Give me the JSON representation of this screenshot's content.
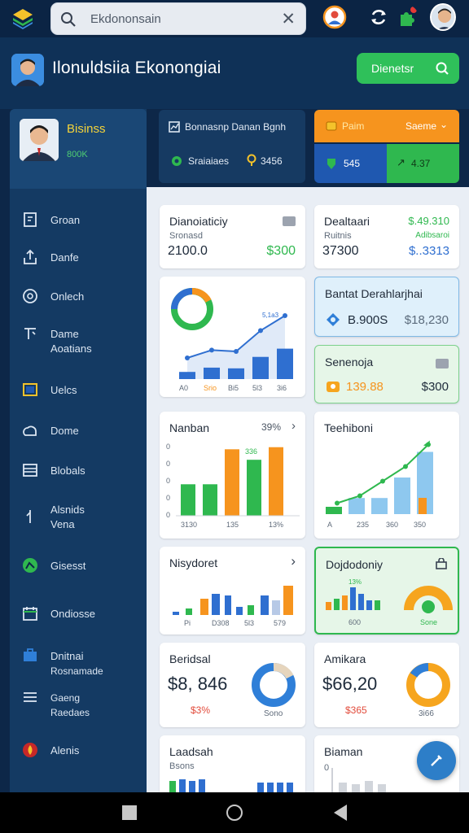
{
  "search": {
    "value": "Ekdononsain"
  },
  "header": {
    "title": "Ilonuldsiia Ekonongiai",
    "button_label": "Dienetsr"
  },
  "profile": {
    "name": "Bisinss",
    "sub": "800K"
  },
  "sidebar": {
    "items": [
      {
        "label": "Groan"
      },
      {
        "label": "Danfe"
      },
      {
        "label": "Onlech"
      },
      {
        "label": "Dame",
        "sub": "Aoatians"
      },
      {
        "label": "Uelcs"
      },
      {
        "label": "Dome"
      },
      {
        "label": "Blobals"
      },
      {
        "label": "Alsnids",
        "sub": "Vena"
      },
      {
        "label": "Gisesst"
      },
      {
        "label": "Ondiosse"
      },
      {
        "label": "Dnitnai",
        "sub": "Rosnamade"
      },
      {
        "label": "Gaeng",
        "sub": "Raedaes"
      },
      {
        "label": "Alenis"
      }
    ]
  },
  "summary_dark": {
    "title": "Bonnasnp Danan Bgnh",
    "stat_label": "Sraiaiaes",
    "stat_value": "3456"
  },
  "summary_orange": {
    "left": "Paim",
    "right": "Saeme",
    "bottom_left": "545",
    "bottom_right": "4.37"
  },
  "cards": {
    "c1": {
      "title": "Dianoiaticiy",
      "sub": "Sronasd",
      "value": "2100.0",
      "value2": "$300"
    },
    "c2": {
      "title": "Dealtaari",
      "sub": "Ruitnis",
      "value": "37300",
      "price": "$.49.310",
      "price_sub": "Adibsaroi",
      "price2": "$..3313"
    },
    "c3": {
      "x_labels": [
        "A0",
        "Srio",
        "Bi5",
        "5l3",
        "3i6"
      ],
      "value_label": "5,1a3"
    },
    "c4": {
      "title": "Bantat Derahlarjhai",
      "value": "B.900S",
      "value2": "$18,230"
    },
    "c5": {
      "title": "Senenoja",
      "value": "139.88",
      "value2": "$300"
    },
    "c6": {
      "title": "Nanban",
      "pct": "39%",
      "x_labels": [
        "3130",
        "135",
        "13%"
      ],
      "y_labels": [
        "0",
        "0",
        "0",
        "0",
        "0"
      ],
      "bar_label": "336"
    },
    "c7": {
      "title": "Teehiboni",
      "x_labels": [
        "A",
        "235",
        "360",
        "350"
      ]
    },
    "c8": {
      "title": "Nisydoret",
      "x_labels": [
        "Pi",
        "D308",
        "5l3",
        "579"
      ]
    },
    "c9": {
      "title": "Dojdodoniy",
      "sub_label": "13%",
      "x_label": "600",
      "donut_label": "Sone"
    },
    "c10": {
      "title": "Beridsal",
      "value": "$8, 846",
      "sub": "$3%",
      "donut_label": "Sono"
    },
    "c11": {
      "title": "Amikara",
      "value": "$66,20",
      "sub": "$365",
      "donut_label": "3i66"
    },
    "c12": {
      "title": "Laadsah",
      "sub": "Bsons"
    },
    "c13": {
      "title": "Biaman",
      "y_label": "0"
    }
  },
  "colors": {
    "blue": "#2f6fd0",
    "green": "#2fb84f",
    "orange": "#f6941e",
    "navy": "#0d2748"
  },
  "chart_data": [
    {
      "type": "line",
      "x": [
        "A0",
        "Srio",
        "Bi5",
        "5l3",
        "3i6"
      ],
      "series": [
        {
          "values": [
            20,
            32,
            30,
            62,
            85
          ]
        }
      ]
    },
    {
      "type": "bar",
      "series": [
        {
          "values": [
            4.5,
            4.5,
            9.5,
            8,
            9.8
          ]
        }
      ],
      "colors": [
        "#2fb84f",
        "#2fb84f",
        "#f6941e",
        "#2fb84f",
        "#f6941e"
      ]
    },
    {
      "type": "bar",
      "series": [
        {
          "values": [
            1,
            2.2,
            2.2,
            5,
            8.5
          ]
        }
      ],
      "line": [
        1.5,
        2.5,
        4.5,
        6.5,
        9.5
      ]
    }
  ]
}
